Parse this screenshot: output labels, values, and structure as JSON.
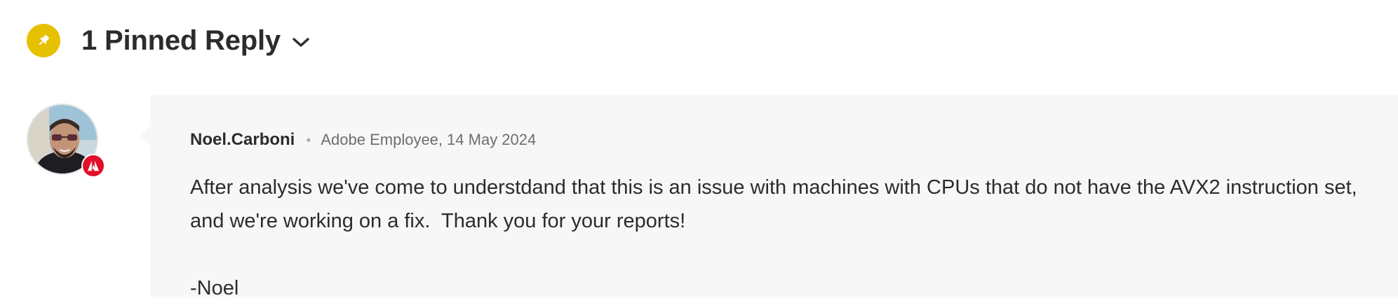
{
  "header": {
    "title": "1 Pinned Reply",
    "pin_icon": "pin-icon",
    "toggle_icon": "chevron-down-icon"
  },
  "reply": {
    "author": "Noel.Carboni",
    "role": "Adobe Employee",
    "date": "14 May 2024",
    "avatar_badge_icon": "adobe-logo-icon",
    "body": {
      "line1": "After analysis we've come to understdand that this is an issue with machines with CPUs that do not have the AVX2 instruction set,",
      "line2": "and we're working on a fix.  Thank you for your reports!",
      "signature": "-Noel"
    }
  },
  "colors": {
    "pin_badge": "#e6c100",
    "adobe_badge": "#e0102a",
    "card_background": "#f7f7f7",
    "text": "#2c2c2c",
    "meta_text": "#6e6e6e"
  }
}
